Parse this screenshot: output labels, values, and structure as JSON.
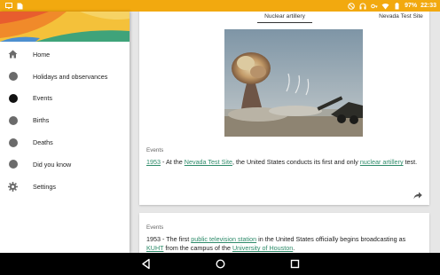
{
  "status_bar": {
    "left_icons": [
      "screen-icon",
      "document-icon"
    ],
    "right_icons": [
      "do-not-disturb-icon",
      "headset-icon",
      "key-icon",
      "wifi-icon",
      "battery-icon"
    ],
    "battery_percent": "97%",
    "time": "22:33",
    "color": "#f2a90f"
  },
  "drawer": {
    "items": [
      {
        "label": "Home",
        "icon": "home-icon"
      },
      {
        "label": "Holidays and observances",
        "icon": "dot-icon"
      },
      {
        "label": "Events",
        "icon": "dot-icon",
        "active": true
      },
      {
        "label": "Births",
        "icon": "dot-icon"
      },
      {
        "label": "Deaths",
        "icon": "dot-icon"
      },
      {
        "label": "Did you know",
        "icon": "dot-icon"
      },
      {
        "label": "Settings",
        "icon": "gear-icon"
      }
    ]
  },
  "card1": {
    "tabs": [
      "Nuclear artillery",
      "Nevada Test Site"
    ],
    "section_label": "Events",
    "year": "1953",
    "sep1": " - At the ",
    "link1": "Nevada Test Site",
    "mid": ", the United States conducts its first and only ",
    "link2": "nuclear artillery",
    "end": " test."
  },
  "card2": {
    "section_label": "Events",
    "prefix": "1953 - The first ",
    "link1": "public television station",
    "mid1": " in the United States officially begins broadcasting as ",
    "link2": "KUHT",
    "mid2": " from the campus of the ",
    "link3": "University of Houston",
    "end": "."
  },
  "colors": {
    "link": "#2e8b6a",
    "accent": "#f2a90f"
  }
}
